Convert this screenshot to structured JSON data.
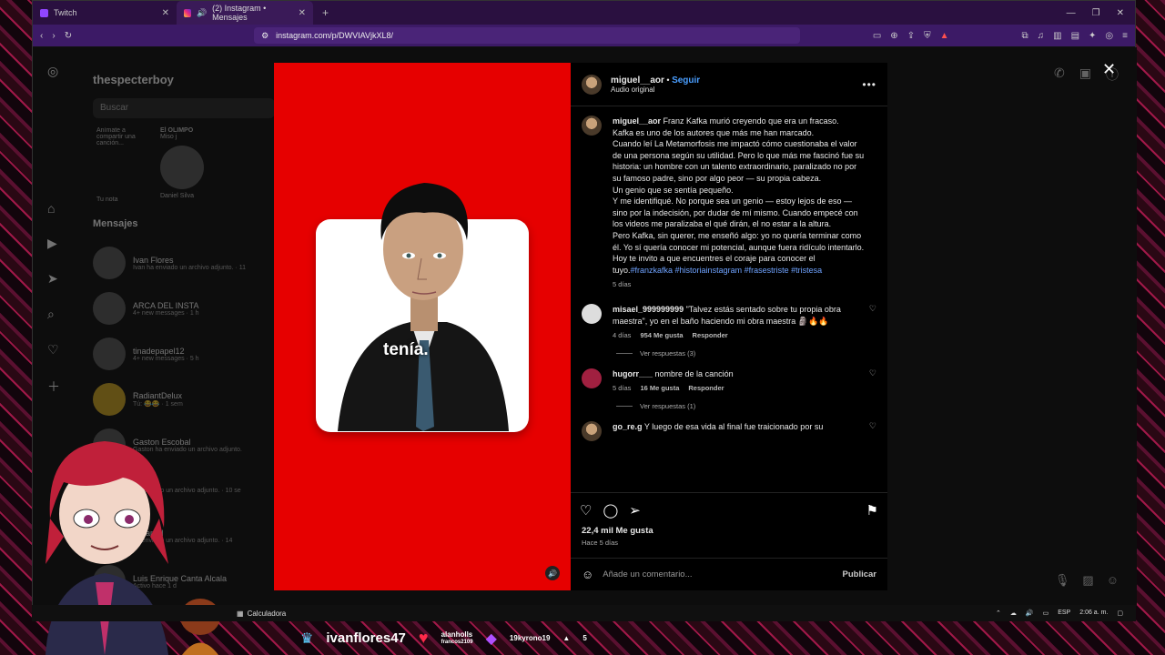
{
  "browser": {
    "tabs": [
      {
        "label": "Twitch"
      },
      {
        "label": "(2) Instagram • Mensajes"
      }
    ],
    "new_tab": "+",
    "url": "instagram.com/p/DWVIAVjkXL8/"
  },
  "instagram_bg": {
    "account": "thespecterboy",
    "search_placeholder": "Buscar",
    "notes": {
      "my_note_prompt": "Anímate a compartir una canción...",
      "my_note_label": "Tu nota",
      "friend_note_title": "El OLIMPO",
      "friend_note_sub": "Miso j",
      "friend_name": "Daniel Silva"
    },
    "messages_title": "Mensajes",
    "conversations": [
      {
        "name": "Ivan Flores",
        "sub": "Ivan ha enviado un archivo adjunto. · 11"
      },
      {
        "name": "ARCA DEL INSTA",
        "sub": "4+ new messages · 1 h"
      },
      {
        "name": "tinadepapel12",
        "sub": "4+ new messages · 5 h"
      },
      {
        "name": "RadiantDelux",
        "sub": "Tú: 😂😂 · 1 sem"
      },
      {
        "name": "Gaston Escobal",
        "sub": "Gaston ha enviado un archivo adjunto."
      },
      {
        "name": "",
        "sub": "ha enviado un archivo adjunto. · 10 se"
      },
      {
        "name": "Retamal",
        "sub": "ha enviado un archivo adjunto. · 14"
      },
      {
        "name": "Luis Enrique Canta Alcala",
        "sub": "Activo hace 1 d"
      }
    ]
  },
  "post": {
    "overlay_caption": "tenía.",
    "author": "miguel__aor",
    "follow_label": "Seguir",
    "audio": "Audio original",
    "caption_lines": [
      "Franz Kafka murió creyendo que era un fracaso.",
      "Kafka es uno de los autores que más me han marcado.",
      "Cuando leí La Metamorfosis me impactó cómo cuestionaba el valor de una persona según su utilidad. Pero lo que más me fascinó fue su historia: un hombre con un talento extraordinario, paralizado no por su famoso padre, sino por algo peor — su propia cabeza.",
      "Un genio que se sentía pequeño.",
      "Y me identifiqué. No porque sea un genio — estoy lejos de eso — sino por la indecisión, por dudar de mí mismo. Cuando empecé con los videos me paralizaba el qué dirán, el no estar a la altura.",
      "Pero Kafka, sin querer, me enseñó algo: yo no quería terminar como él. Yo sí quería conocer mi potencial, aunque fuera ridículo intentarlo.",
      "Hoy te invito a que encuentres el coraje para conocer el tuyo."
    ],
    "hashtags": "#franzkafka #historiainstagram #frasestriste #tristesa",
    "caption_age": "5 días",
    "comments": [
      {
        "user": "misael_999999999",
        "text": "\"Talvez estás sentado sobre tu propia obra maestra\", yo en el baño haciendo mi obra maestra 🗿🔥🔥",
        "age": "4 días",
        "likes": "954 Me gusta",
        "reply": "Responder",
        "view_replies": "Ver respuestas (3)"
      },
      {
        "user": "hugorr___",
        "text": "nombre de la canción",
        "age": "5 días",
        "likes": "16 Me gusta",
        "reply": "Responder",
        "view_replies": "Ver respuestas (1)"
      },
      {
        "user": "go_re.g",
        "text": "Y luego de esa vida al final fue traicionado por su"
      }
    ],
    "likes_total": "22,4 mil Me gusta",
    "posted_ago": "Hace 5 días",
    "comment_placeholder": "Añade un comentario...",
    "publish_label": "Publicar"
  },
  "taskbar": {
    "app": "Calculadora",
    "lang": "ESP",
    "time": "2:06 a. m."
  },
  "stream_overlay": {
    "streamer": "ivanflores47",
    "donor_top": "alanholls",
    "donor_bottom": "francos2109",
    "sub_user": "19kyrono19",
    "sub_count": "5"
  }
}
